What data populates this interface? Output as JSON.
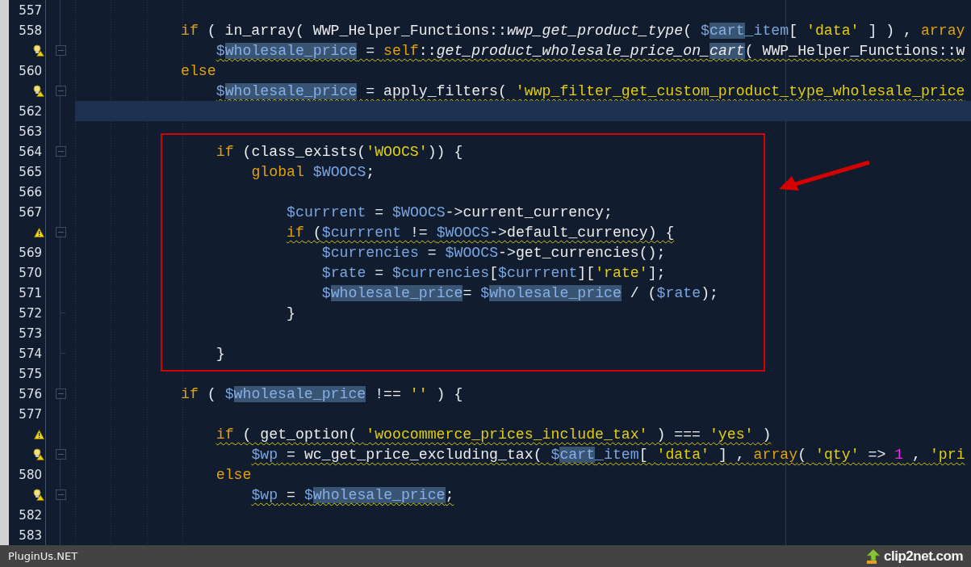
{
  "editor": {
    "lines": [
      {
        "number": "557",
        "current": false
      },
      {
        "number": "558",
        "current": false,
        "squiggle": false,
        "tokens": [
          {
            "kind": "kw",
            "t": "            if"
          },
          {
            "kind": "plain",
            "t": " ( in_array( WWP_Helper_Functions::"
          },
          {
            "kind": "italic",
            "t": "wwp_get_product_type"
          },
          {
            "kind": "plain",
            "t": "( "
          },
          {
            "kind": "var",
            "t": "$"
          },
          {
            "kind": "hl",
            "t": "cart"
          },
          {
            "kind": "var",
            "t": "_item"
          },
          {
            "kind": "plain",
            "t": "[ "
          },
          {
            "kind": "str",
            "t": "'data'"
          },
          {
            "kind": "plain",
            "t": " ] ) , "
          },
          {
            "kind": "kw",
            "t": "array"
          }
        ]
      },
      {
        "marker": {
          "kind": "hint"
        },
        "fold": {
          "kind": "open"
        },
        "current": false,
        "squiggle": true,
        "tokens": [
          {
            "kind": "var",
            "t": "                $"
          },
          {
            "kind": "hl",
            "t": "wholesale_price"
          },
          {
            "kind": "plain",
            "t": " = "
          },
          {
            "kind": "kw",
            "t": "self"
          },
          {
            "kind": "plain",
            "t": "::"
          },
          {
            "kind": "italic",
            "t": "get_product_wholesale_price_on_"
          },
          {
            "kind": "hlitalic",
            "t": "cart"
          },
          {
            "kind": "plain",
            "t": "( WWP_Helper_Functions::w"
          }
        ]
      },
      {
        "number": "560",
        "current": false,
        "squiggle": false,
        "tokens": [
          {
            "kind": "kw",
            "t": "            else"
          }
        ]
      },
      {
        "marker": {
          "kind": "hint"
        },
        "fold": {
          "kind": "open"
        },
        "current": false,
        "squiggle": true,
        "tokens": [
          {
            "kind": "var",
            "t": "                $"
          },
          {
            "kind": "hl",
            "t": "wholesale_price"
          },
          {
            "kind": "plain",
            "t": " = apply_filters( "
          },
          {
            "kind": "str",
            "t": "'wwp_filter_get_custom_product_type_wholesale_price"
          }
        ]
      },
      {
        "number": "562",
        "current": true
      },
      {
        "number": "563",
        "current": false
      },
      {
        "number": "564",
        "fold": {
          "kind": "open"
        },
        "current": false,
        "squiggle": false,
        "tokens": [
          {
            "kind": "kw",
            "t": "                if"
          },
          {
            "kind": "plain",
            "t": " (class_exists("
          },
          {
            "kind": "str",
            "t": "'WOOCS'"
          },
          {
            "kind": "plain",
            "t": ")) {"
          }
        ]
      },
      {
        "number": "565",
        "current": false,
        "squiggle": false,
        "tokens": [
          {
            "kind": "kw",
            "t": "                    global"
          },
          {
            "kind": "var",
            "t": " $WOOCS"
          },
          {
            "kind": "plain",
            "t": ";"
          }
        ]
      },
      {
        "number": "566",
        "current": false
      },
      {
        "number": "567",
        "current": false,
        "squiggle": false,
        "tokens": [
          {
            "kind": "var",
            "t": "                        $currrent"
          },
          {
            "kind": "plain",
            "t": " = "
          },
          {
            "kind": "var",
            "t": "$WOOCS"
          },
          {
            "kind": "plain",
            "t": "->current_currency;"
          }
        ]
      },
      {
        "marker": {
          "kind": "warning"
        },
        "fold": {
          "kind": "open"
        },
        "current": false,
        "squiggle": true,
        "tokens": [
          {
            "kind": "kw",
            "t": "                        if"
          },
          {
            "kind": "plain",
            "t": " ("
          },
          {
            "kind": "var",
            "t": "$currrent"
          },
          {
            "kind": "plain",
            "t": " != "
          },
          {
            "kind": "var",
            "t": "$WOOCS"
          },
          {
            "kind": "plain",
            "t": "->default_currency) {"
          }
        ]
      },
      {
        "number": "569",
        "current": false,
        "squiggle": false,
        "tokens": [
          {
            "kind": "var",
            "t": "                            $currencies"
          },
          {
            "kind": "plain",
            "t": " = "
          },
          {
            "kind": "var",
            "t": "$WOOCS"
          },
          {
            "kind": "plain",
            "t": "->get_currencies();"
          }
        ]
      },
      {
        "number": "570",
        "current": false,
        "squiggle": false,
        "tokens": [
          {
            "kind": "var",
            "t": "                            $rate"
          },
          {
            "kind": "plain",
            "t": " = "
          },
          {
            "kind": "var",
            "t": "$currencies"
          },
          {
            "kind": "plain",
            "t": "["
          },
          {
            "kind": "var",
            "t": "$currrent"
          },
          {
            "kind": "plain",
            "t": "]["
          },
          {
            "kind": "str",
            "t": "'rate'"
          },
          {
            "kind": "plain",
            "t": "];"
          }
        ]
      },
      {
        "number": "571",
        "current": false,
        "squiggle": false,
        "tokens": [
          {
            "kind": "var",
            "t": "                            $"
          },
          {
            "kind": "hl",
            "t": "wholesale_price"
          },
          {
            "kind": "plain",
            "t": "= "
          },
          {
            "kind": "var",
            "t": "$"
          },
          {
            "kind": "hl",
            "t": "wholesale_price"
          },
          {
            "kind": "plain",
            "t": " / ("
          },
          {
            "kind": "var",
            "t": "$rate"
          },
          {
            "kind": "plain",
            "t": ");"
          }
        ]
      },
      {
        "number": "572",
        "fold": {
          "kind": "end"
        },
        "current": false,
        "squiggle": false,
        "tokens": [
          {
            "kind": "plain",
            "t": "                        }"
          }
        ]
      },
      {
        "number": "573",
        "current": false
      },
      {
        "number": "574",
        "fold": {
          "kind": "end"
        },
        "current": false,
        "squiggle": false,
        "tokens": [
          {
            "kind": "plain",
            "t": "                }"
          }
        ]
      },
      {
        "number": "575",
        "current": false
      },
      {
        "number": "576",
        "fold": {
          "kind": "open"
        },
        "current": false,
        "squiggle": false,
        "tokens": [
          {
            "kind": "kw",
            "t": "            if"
          },
          {
            "kind": "plain",
            "t": " ( "
          },
          {
            "kind": "var",
            "t": "$"
          },
          {
            "kind": "hl",
            "t": "wholesale_price"
          },
          {
            "kind": "plain",
            "t": " !== "
          },
          {
            "kind": "str",
            "t": "''"
          },
          {
            "kind": "plain",
            "t": " ) {"
          }
        ]
      },
      {
        "number": "577",
        "current": false
      },
      {
        "marker": {
          "kind": "warning"
        },
        "current": false,
        "squiggle": true,
        "tokens": [
          {
            "kind": "kw",
            "t": "                if"
          },
          {
            "kind": "plain",
            "t": " ( get_option( "
          },
          {
            "kind": "str",
            "t": "'woocommerce_prices_include_tax'"
          },
          {
            "kind": "plain",
            "t": " ) === "
          },
          {
            "kind": "str",
            "t": "'yes'"
          },
          {
            "kind": "plain",
            "t": " )"
          }
        ]
      },
      {
        "marker": {
          "kind": "hint"
        },
        "fold": {
          "kind": "open"
        },
        "current": false,
        "squiggle": true,
        "tokens": [
          {
            "kind": "var",
            "t": "                    $wp"
          },
          {
            "kind": "plain",
            "t": " = wc_get_price_excluding_tax( "
          },
          {
            "kind": "var",
            "t": "$"
          },
          {
            "kind": "hl",
            "t": "cart"
          },
          {
            "kind": "var",
            "t": "_item"
          },
          {
            "kind": "plain",
            "t": "[ "
          },
          {
            "kind": "str",
            "t": "'data'"
          },
          {
            "kind": "plain",
            "t": " ] , "
          },
          {
            "kind": "kw",
            "t": "array"
          },
          {
            "kind": "plain",
            "t": "( "
          },
          {
            "kind": "str",
            "t": "'qty'"
          },
          {
            "kind": "plain",
            "t": " => "
          },
          {
            "kind": "num",
            "t": "1"
          },
          {
            "kind": "plain",
            "t": " , "
          },
          {
            "kind": "str",
            "t": "'pri"
          }
        ]
      },
      {
        "number": "580",
        "current": false,
        "squiggle": false,
        "tokens": [
          {
            "kind": "kw",
            "t": "                else"
          }
        ]
      },
      {
        "marker": {
          "kind": "hint"
        },
        "fold": {
          "kind": "open"
        },
        "current": false,
        "squiggle": true,
        "tokens": [
          {
            "kind": "var",
            "t": "                    $wp"
          },
          {
            "kind": "plain",
            "t": " = "
          },
          {
            "kind": "var",
            "t": "$"
          },
          {
            "kind": "hl",
            "t": "wholesale_price"
          },
          {
            "kind": "plain",
            "t": ";"
          }
        ]
      },
      {
        "number": "582",
        "current": false
      },
      {
        "number": "583",
        "current": false
      }
    ]
  },
  "footer": {
    "caption": "PluginUs.NET",
    "logo": "clip2net.com"
  }
}
